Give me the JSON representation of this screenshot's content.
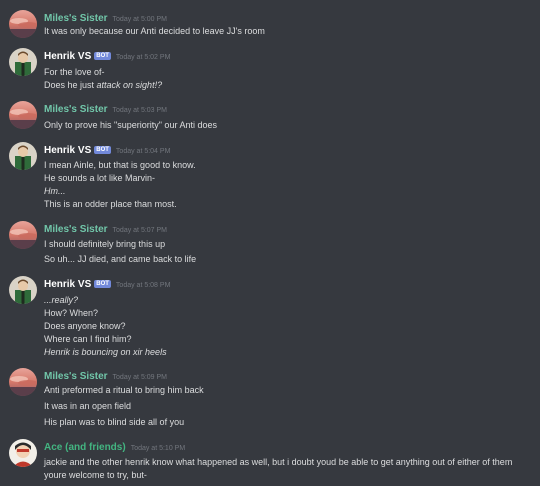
{
  "colors": {
    "background": "#36393f",
    "sister_name": "#71c6a9",
    "henrik_name": "#ffffff",
    "ace_name": "#43b581",
    "bot_badge": "#7289da",
    "timestamp": "#72767d"
  },
  "messages": [
    {
      "author": "Miles's Sister",
      "avatar": "sunset-avatar",
      "bot": false,
      "timestamp": "Today at 5:00 PM",
      "lines": [
        {
          "text": "It was only because our Anti decided to leave JJ's room"
        }
      ]
    },
    {
      "author": "Henrik VS",
      "avatar": "henrik-avatar",
      "bot": true,
      "bot_label": "BOT",
      "timestamp": "Today at 5:02 PM",
      "lines": [
        {
          "text": "For the love of-"
        },
        {
          "text": "Does he just ",
          "emph": "attack on sight!?"
        }
      ]
    },
    {
      "author": "Miles's Sister",
      "avatar": "sunset-avatar",
      "bot": false,
      "timestamp": "Today at 5:03 PM",
      "lines": [
        {
          "text": "Only to prove his \"superiority\" our Anti does"
        }
      ]
    },
    {
      "author": "Henrik VS",
      "avatar": "henrik-avatar",
      "bot": true,
      "bot_label": "BOT",
      "timestamp": "Today at 5:04 PM",
      "lines": [
        {
          "text": "I mean Ainle, but that is good to know."
        },
        {
          "text": "He sounds a lot like Marvin-"
        },
        {
          "text": "Hm...",
          "italic": true
        },
        {
          "text": "This is an odder place than most."
        }
      ]
    },
    {
      "author": "Miles's Sister",
      "avatar": "sunset-avatar",
      "bot": false,
      "timestamp": "Today at 5:07 PM",
      "lines": [
        {
          "text": "I should definitely bring this up"
        },
        {
          "text": "So uh... JJ died, and came back to life"
        }
      ]
    },
    {
      "author": "Henrik VS",
      "avatar": "henrik-avatar",
      "bot": true,
      "bot_label": "BOT",
      "timestamp": "Today at 5:08 PM",
      "lines": [
        {
          "text": "...really?",
          "italic": true
        },
        {
          "text": "How? When?"
        },
        {
          "text": "Does anyone know?"
        },
        {
          "text": "Where can I find him?"
        },
        {
          "text": "Henrik is bouncing on xir heels",
          "italic": true
        }
      ]
    },
    {
      "author": "Miles's Sister",
      "avatar": "sunset-avatar",
      "bot": false,
      "timestamp": "Today at 5:09 PM",
      "lines": [
        {
          "text": "Anti preformed a ritual to bring him back"
        },
        {
          "text": "It was in an open field"
        },
        {
          "text": "His plan was to blind side all of you"
        }
      ]
    },
    {
      "author": "Ace (and friends)",
      "avatar": "ace-avatar",
      "bot": false,
      "timestamp": "Today at 5:10 PM",
      "lines": [
        {
          "text": "jackie and the other henrik know what happened as well, but i doubt youd be able to get anything out of either of them"
        },
        {
          "text": "youre welcome to try, but-"
        }
      ]
    }
  ]
}
